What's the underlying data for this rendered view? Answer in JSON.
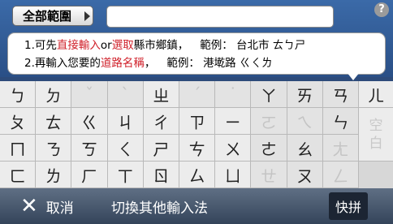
{
  "header": {
    "scope_button_label": "全部範圍",
    "search_value": "",
    "help_label": "?"
  },
  "hint": {
    "line1": {
      "prefix": "1.可先",
      "highlight1": "直接輸入",
      "or": "or",
      "highlight2": "選取",
      "suffix": "縣市鄉鎮，",
      "example": "範例： 台北市   ㄊㄅㄕ"
    },
    "line2": {
      "prefix": "2.再輸入您要的",
      "highlight": "道路名稱",
      "suffix": "，",
      "example": "範例： 港墘路   ㄍㄑㄌ"
    }
  },
  "keyboard": {
    "rows": [
      [
        "ㄅ",
        "ㄉ",
        "ˇ",
        "ˋ",
        "ㄓ",
        "ˊ",
        "˙",
        "ㄚ",
        "ㄞ",
        "ㄢ"
      ],
      [
        "ㄆ",
        "ㄊ",
        "ㄍ",
        "ㄐ",
        "ㄔ",
        "ㄗ",
        "ㄧ",
        "ㄛ",
        "ㄟ",
        "ㄣ"
      ],
      [
        "ㄇ",
        "ㄋ",
        "ㄎ",
        "ㄑ",
        "ㄕ",
        "ㄘ",
        "ㄨ",
        "ㄜ",
        "ㄠ",
        "ㄤ"
      ],
      [
        "ㄈ",
        "ㄌ",
        "ㄏ",
        "ㄒ",
        "ㄖ",
        "ㄙ",
        "ㄩ",
        "ㄝ",
        "ㄡ",
        "ㄥ"
      ]
    ],
    "side_top": "ㄦ",
    "space_label_1": "空",
    "space_label_2": "白"
  },
  "bottom_bar": {
    "cancel_label": "取消",
    "switch_label": "切換其他輸入法",
    "quick_label": "快拼"
  },
  "colors": {
    "highlight": "#d0202a",
    "header_bg": "#2a4f86",
    "bottom_bg": "#34445a"
  }
}
